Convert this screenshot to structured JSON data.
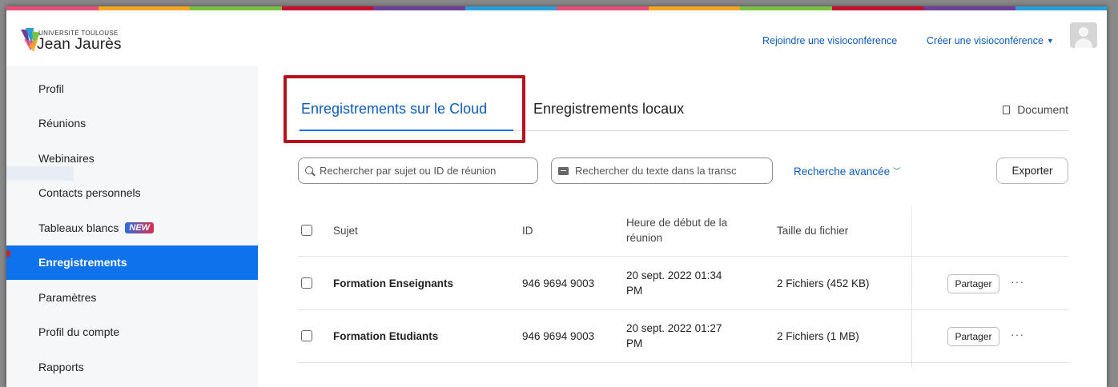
{
  "header": {
    "logo_line1": "UNIVERSITÉ TOULOUSE",
    "logo_line2": "Jean Jaurès",
    "join_link": "Rejoindre une visioconférence",
    "create_link": "Créer une visioconférence",
    "create_caret": "▼"
  },
  "brand_colors": [
    "#e94e77",
    "#f5a623",
    "#7ac143",
    "#c8102e",
    "#6d3f99",
    "#2a9fd6",
    "#e94e77",
    "#f5a623",
    "#7ac143",
    "#c8102e",
    "#6d3f99",
    "#2a9fd6"
  ],
  "sidebar": {
    "items": [
      {
        "label": "Profil"
      },
      {
        "label": "Réunions"
      },
      {
        "label": "Webinaires"
      },
      {
        "label": "Contacts personnels"
      },
      {
        "label": "Tableaux blancs",
        "badge": "NEW"
      },
      {
        "label": "Enregistrements",
        "active": true
      },
      {
        "label": "Paramètres"
      },
      {
        "label": "Profil du compte"
      },
      {
        "label": "Rapports"
      }
    ],
    "active_color": "#0e72ed"
  },
  "tabs": {
    "cloud": "Enregistrements sur le Cloud",
    "local": "Enregistrements locaux",
    "document": "Document"
  },
  "search": {
    "subject_placeholder": "Rechercher par sujet ou ID de réunion",
    "transcript_placeholder": "Rechercher du texte dans la transc",
    "advanced": "Recherche avancée",
    "advanced_chevron": "﹀",
    "export": "Exporter"
  },
  "table": {
    "headers": {
      "subject": "Sujet",
      "id": "ID",
      "start_line1": "Heure de début de la",
      "start_line2": "réunion",
      "size": "Taille du fichier"
    },
    "rows": [
      {
        "subject": "Formation Enseignants",
        "id": "946 9694 9003",
        "start_line1": "20 sept. 2022 01:34",
        "start_line2": "PM",
        "size": "2 Fichiers (452 KB)",
        "share": "Partager",
        "more": "···"
      },
      {
        "subject": "Formation Etudiants",
        "id": "946 9694 9003",
        "start_line1": "20 sept. 2022 01:27",
        "start_line2": "PM",
        "size": "2 Fichiers (1 MB)",
        "share": "Partager",
        "more": "···"
      }
    ]
  },
  "highlight_color": "#b5121b",
  "link_color": "#0e5cb8"
}
